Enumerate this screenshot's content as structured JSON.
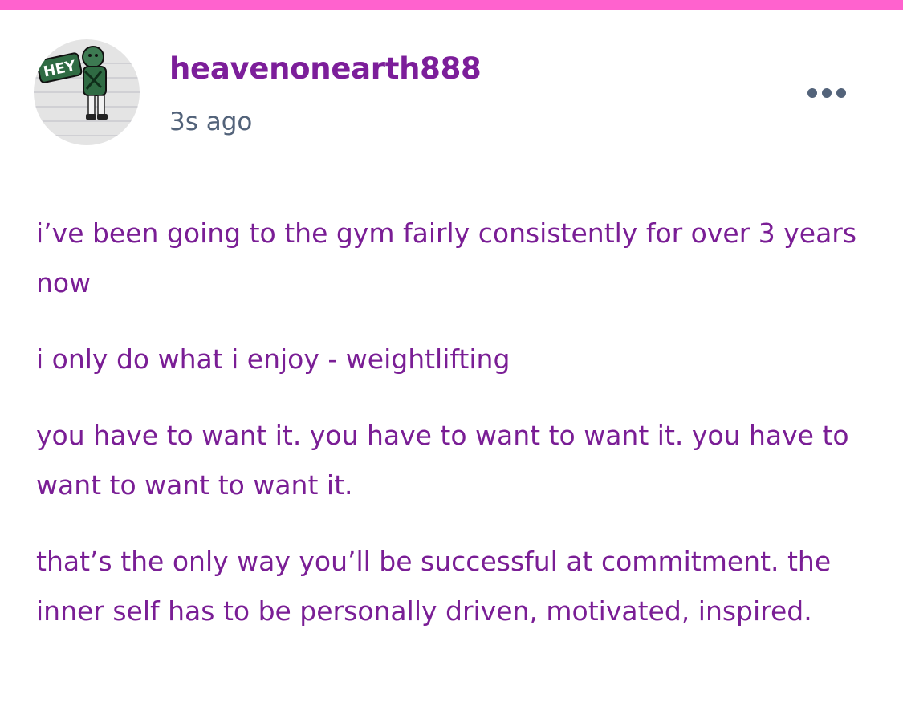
{
  "colors": {
    "top_bar": "#ff62ce",
    "username": "#7c1e9a",
    "timestamp": "#53637a",
    "body_text": "#7a1e95",
    "more_dots": "#53637a"
  },
  "post": {
    "avatar_icon": "cartoon-character-sticker-avatar",
    "avatar_sticker_text": "HEY",
    "username": "heavenonearth888",
    "timestamp": "3s ago",
    "more_icon": "ellipsis-icon",
    "paragraphs": [
      "i’ve been going to the gym fairly consistently for over 3 years now",
      "i only do what i enjoy - weightlifting",
      "you have to want it. you have to want to want it. you have to want to want to want it.",
      "that’s the only way you’ll be successful at commitment. the inner self has to be personally driven, motivated, inspired."
    ]
  }
}
